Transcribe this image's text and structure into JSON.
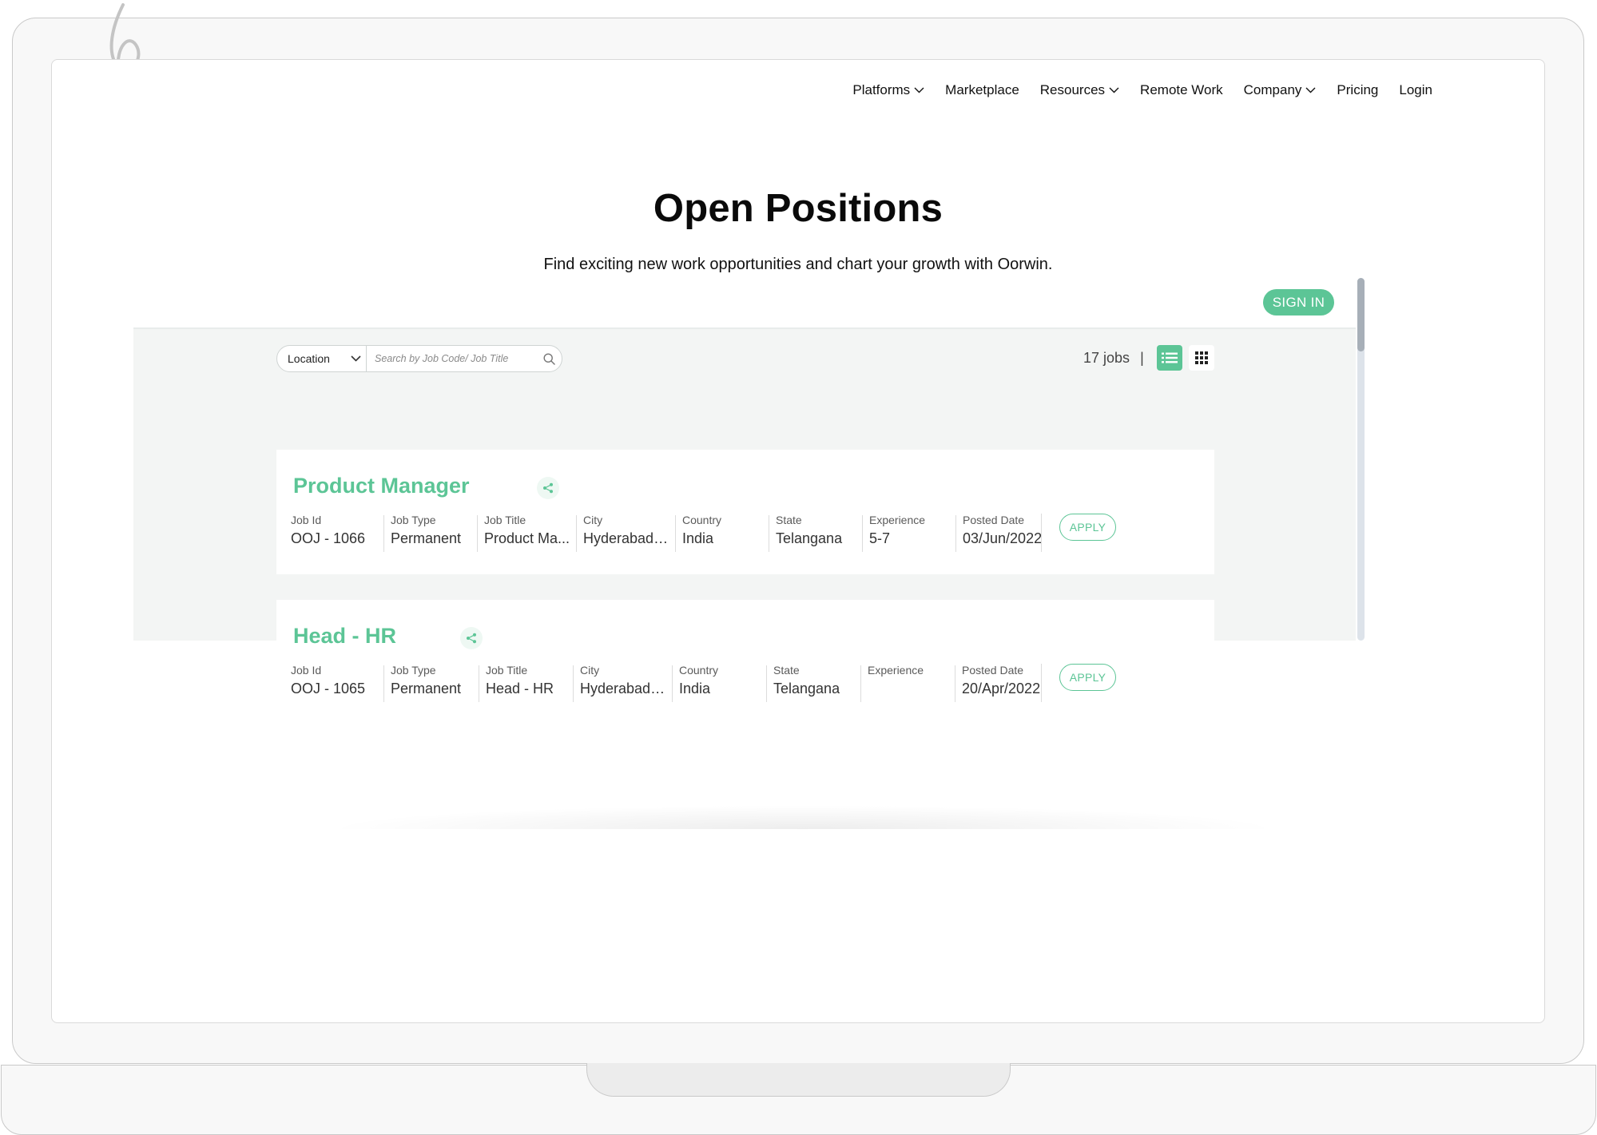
{
  "nav": {
    "items": [
      {
        "label": "Platforms",
        "has_dropdown": true
      },
      {
        "label": "Marketplace",
        "has_dropdown": false
      },
      {
        "label": "Resources",
        "has_dropdown": true
      },
      {
        "label": "Remote Work",
        "has_dropdown": false
      },
      {
        "label": "Company",
        "has_dropdown": true
      },
      {
        "label": "Pricing",
        "has_dropdown": false
      },
      {
        "label": "Login",
        "has_dropdown": false
      }
    ]
  },
  "hero": {
    "title": "Open Positions",
    "subtitle": "Find exciting new work opportunities and chart your growth with Oorwin."
  },
  "portal": {
    "signin_label": "SIGN IN",
    "location_label": "Location",
    "search_placeholder": "Search by Job Code/ Job Title",
    "job_count": "17 jobs",
    "count_separator": "|",
    "apply_label": "APPLY",
    "field_labels": {
      "job_id": "Job Id",
      "job_type": "Job Type",
      "job_title": "Job Title",
      "city": "City",
      "country": "Country",
      "state": "State",
      "experience": "Experience",
      "posted_date": "Posted Date"
    },
    "jobs": [
      {
        "title": "Product Manager",
        "job_id": "OOJ - 1066",
        "job_type": "Permanent",
        "job_title": "Product Ma...",
        "city": "Hyderabad,...",
        "country": "India",
        "state": "Telangana",
        "experience": "5-7",
        "posted_date": "03/Jun/2022"
      },
      {
        "title": "Head - HR",
        "job_id": "OOJ - 1065",
        "job_type": "Permanent",
        "job_title": "Head - HR",
        "city": "Hyderabad,...",
        "country": "India",
        "state": "Telangana",
        "experience": "",
        "posted_date": "20/Apr/2022"
      }
    ]
  },
  "colors": {
    "accent": "#5cc596",
    "panel_bg": "#f3f5f4",
    "text": "#111111"
  },
  "icons": {
    "nav_caret": "chevron-down-icon",
    "search": "search-icon",
    "share": "share-icon",
    "list_view": "list-view-icon",
    "grid_view": "grid-view-icon",
    "decorative_arrow": "curly-arrow-icon"
  }
}
